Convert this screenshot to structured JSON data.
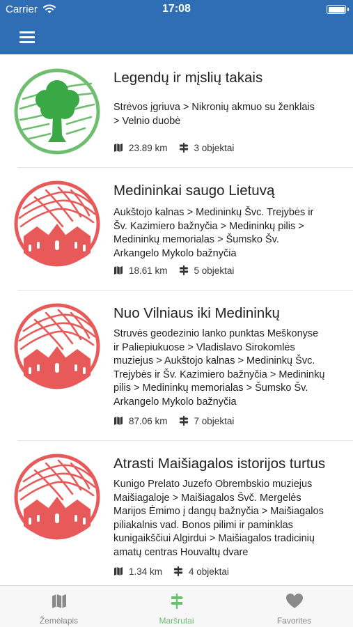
{
  "status_bar": {
    "carrier": "Carrier",
    "time": "17:08"
  },
  "routes": [
    {
      "title": "Legendų ir mįslių takais",
      "description_lines": [
        "Strėvos įgriuva  > Nikronių akmuo su ženklais",
        "> Velnio duobė"
      ],
      "distance": "23.89 km",
      "objects": "3 objektai",
      "icon": "tree-icon",
      "color": "#6dbf6f"
    },
    {
      "title": "Medininkai saugo Lietuvą",
      "description_lines": [
        "Aukštojo kalnas  > Medininkų Švc. Trejybės ir",
        "Šv. Kazimiero bažnyčia > Medininkų pilis  >",
        "Medininkų memorialas > Šumsko Šv.",
        "Arkangelo Mykolo bažnyčia"
      ],
      "distance": "18.61 km",
      "objects": "5 objektai",
      "icon": "castle-icon",
      "color": "#e85a5a"
    },
    {
      "title": "Nuo Vilniaus iki Medininkų",
      "description_lines": [
        "Struvės geodezinio lanko punktas Meškonyse",
        "ir Paliepiukuose > Vladislavo Sirokomlės",
        "muziejus > Aukštojo kalnas  > Medininkų Švc.",
        "Trejybės ir Šv. Kazimiero bažnyčia > Medininkų",
        "pilis  > Medininkų memorialas > Šumsko Šv.",
        "Arkangelo Mykolo bažnyčia"
      ],
      "distance": "87.06 km",
      "objects": "7 objektai",
      "icon": "castle-icon",
      "color": "#e85a5a"
    },
    {
      "title": "Atrasti Maišiagalos istorijos turtus",
      "description_lines": [
        "Kunigo Prelato Juzefo Obrembskio muziejus",
        "Maišiagaloje > Maišiagalos Švč. Mergelės",
        "Marijos Ėmimo į dangų bažnyčia > Maišiagalos",
        "piliakalnis vad. Bonos pilimi ir paminklas",
        "kunigaikščiui Algirdui > Maišiagalos tradicinių",
        "amatų centras Houvaltų dvare"
      ],
      "distance": "1.34 km",
      "objects": "4 objektai",
      "icon": "castle-icon",
      "color": "#e85a5a"
    }
  ],
  "tab_bar": {
    "tabs": [
      {
        "label": "Žemėlapis",
        "icon": "map-icon",
        "active": false
      },
      {
        "label": "Maršrutai",
        "icon": "signpost-icon",
        "active": true
      },
      {
        "label": "Favorites",
        "icon": "heart-icon",
        "active": false
      }
    ]
  },
  "colors": {
    "nav_bar": "#2f6db4",
    "active_tab": "#6bbf73",
    "inactive_tab": "#8a8a8a",
    "green_icon": "#6dbf6f",
    "red_icon": "#e85a5a"
  }
}
